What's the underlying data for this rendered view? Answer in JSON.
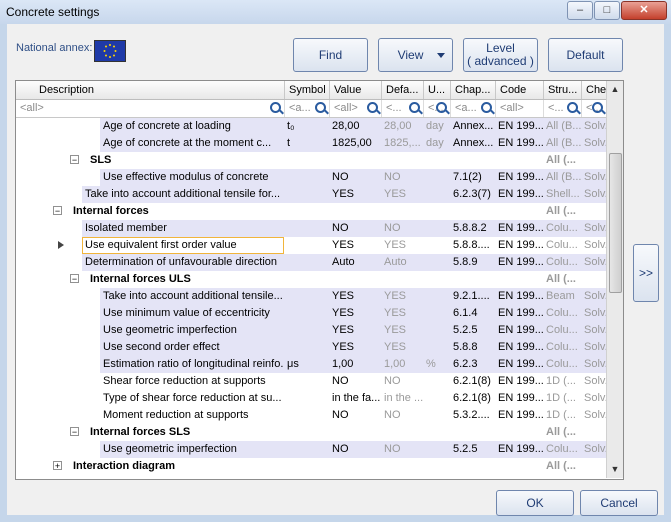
{
  "window": {
    "title": "Concrete settings"
  },
  "national_annex": {
    "label": "National annex:",
    "flag_icon": "eu-flag-icon"
  },
  "toolbar": {
    "find": "Find",
    "view": "View",
    "level_line1": "Level",
    "level_line2": "( advanced )",
    "default": "Default"
  },
  "columns": [
    "Description",
    "Symbol",
    "Value",
    "Defa...",
    "U...",
    "Chap...",
    "Code",
    "Stru...",
    "Che..."
  ],
  "filters": [
    "<all>",
    "<a...",
    "<all>",
    "<...",
    "<...",
    "<a...",
    "<all>",
    "<...",
    "<..."
  ],
  "rows": [
    {
      "desc": "Age of concrete at loading",
      "sym": "t₀",
      "val": "28,00",
      "def": "28,00",
      "unit": "day",
      "chap": "Annex...",
      "code": "EN 199...",
      "stru": "All (B...",
      "che": "Solv..."
    },
    {
      "desc": "Age of concrete at the moment c...",
      "sym": "t",
      "val": "1825,00",
      "def": "1825,...",
      "unit": "day",
      "chap": "Annex...",
      "code": "EN 199...",
      "stru": "All (B...",
      "che": "Solv..."
    },
    {
      "desc": "SLS",
      "sym": "",
      "val": "",
      "def": "",
      "unit": "",
      "chap": "",
      "code": "",
      "stru": "All (...",
      "che": ""
    },
    {
      "desc": "Use effective modulus of concrete",
      "sym": "",
      "val": "NO",
      "def": "NO",
      "unit": "",
      "chap": "7.1(2)",
      "code": "EN 199...",
      "stru": "All (B...",
      "che": "Solv..."
    },
    {
      "desc": "Take into account additional tensile for...",
      "sym": "",
      "val": "YES",
      "def": "YES",
      "unit": "",
      "chap": "6.2.3(7)",
      "code": "EN 199...",
      "stru": "Shell...",
      "che": "Solv..."
    },
    {
      "desc": "Internal forces",
      "sym": "",
      "val": "",
      "def": "",
      "unit": "",
      "chap": "",
      "code": "",
      "stru": "All (...",
      "che": ""
    },
    {
      "desc": "Isolated member",
      "sym": "",
      "val": "NO",
      "def": "NO",
      "unit": "",
      "chap": "5.8.8.2",
      "code": "EN 199...",
      "stru": "Colu...",
      "che": "Solv..."
    },
    {
      "desc": "Use equivalent first order value",
      "sym": "",
      "val": "YES",
      "def": "YES",
      "unit": "",
      "chap": "5.8.8....",
      "code": "EN 199...",
      "stru": "Colu...",
      "che": "Solv..."
    },
    {
      "desc": "Determination of unfavourable direction",
      "sym": "",
      "val": "Auto",
      "def": "Auto",
      "unit": "",
      "chap": "5.8.9",
      "code": "EN 199...",
      "stru": "Colu...",
      "che": "Solv..."
    },
    {
      "desc": "Internal forces ULS",
      "sym": "",
      "val": "",
      "def": "",
      "unit": "",
      "chap": "",
      "code": "",
      "stru": "All (...",
      "che": ""
    },
    {
      "desc": "Take into account additional tensile...",
      "sym": "",
      "val": "YES",
      "def": "YES",
      "unit": "",
      "chap": "9.2.1....",
      "code": "EN 199...",
      "stru": "Beam",
      "che": "Solv..."
    },
    {
      "desc": "Use minimum value of eccentricity",
      "sym": "",
      "val": "YES",
      "def": "YES",
      "unit": "",
      "chap": "6.1.4",
      "code": "EN 199...",
      "stru": "Colu...",
      "che": "Solv..."
    },
    {
      "desc": "Use geometric imperfection",
      "sym": "",
      "val": "YES",
      "def": "YES",
      "unit": "",
      "chap": "5.2.5",
      "code": "EN 199...",
      "stru": "Colu...",
      "che": "Solv..."
    },
    {
      "desc": "Use second order effect",
      "sym": "",
      "val": "YES",
      "def": "YES",
      "unit": "",
      "chap": "5.8.8",
      "code": "EN 199...",
      "stru": "Colu...",
      "che": "Solv..."
    },
    {
      "desc": "Estimation ratio of longitudinal reinfo...",
      "sym": "μs",
      "val": "1,00",
      "def": "1,00",
      "unit": "%",
      "chap": "6.2.3",
      "code": "EN 199...",
      "stru": "Colu...",
      "che": "Solv..."
    },
    {
      "desc": "Shear force reduction at supports",
      "sym": "",
      "val": "NO",
      "def": "NO",
      "unit": "",
      "chap": "6.2.1(8)",
      "code": "EN 199...",
      "stru": "1D (...",
      "che": "Solv..."
    },
    {
      "desc": "Type of shear force reduction at su...",
      "sym": "",
      "val": "in the fa...",
      "def": "in the ...",
      "unit": "",
      "chap": "6.2.1(8)",
      "code": "EN 199...",
      "stru": "1D (...",
      "che": "Solv..."
    },
    {
      "desc": "Moment reduction at supports",
      "sym": "",
      "val": "NO",
      "def": "NO",
      "unit": "",
      "chap": "5.3.2....",
      "code": "EN 199...",
      "stru": "1D (...",
      "che": "Solv..."
    },
    {
      "desc": "Internal forces SLS",
      "sym": "",
      "val": "",
      "def": "",
      "unit": "",
      "chap": "",
      "code": "",
      "stru": "All (...",
      "che": ""
    },
    {
      "desc": "Use geometric imperfection",
      "sym": "",
      "val": "NO",
      "def": "NO",
      "unit": "",
      "chap": "5.2.5",
      "code": "EN 199...",
      "stru": "Colu...",
      "che": "Solv..."
    },
    {
      "desc": "Interaction diagram",
      "sym": "",
      "val": "",
      "def": "",
      "unit": "",
      "chap": "",
      "code": "",
      "stru": "All (...",
      "che": ""
    }
  ],
  "side_button": ">>",
  "ok": "OK",
  "cancel": "Cancel",
  "expander_minus": "−",
  "expander_plus": "+"
}
